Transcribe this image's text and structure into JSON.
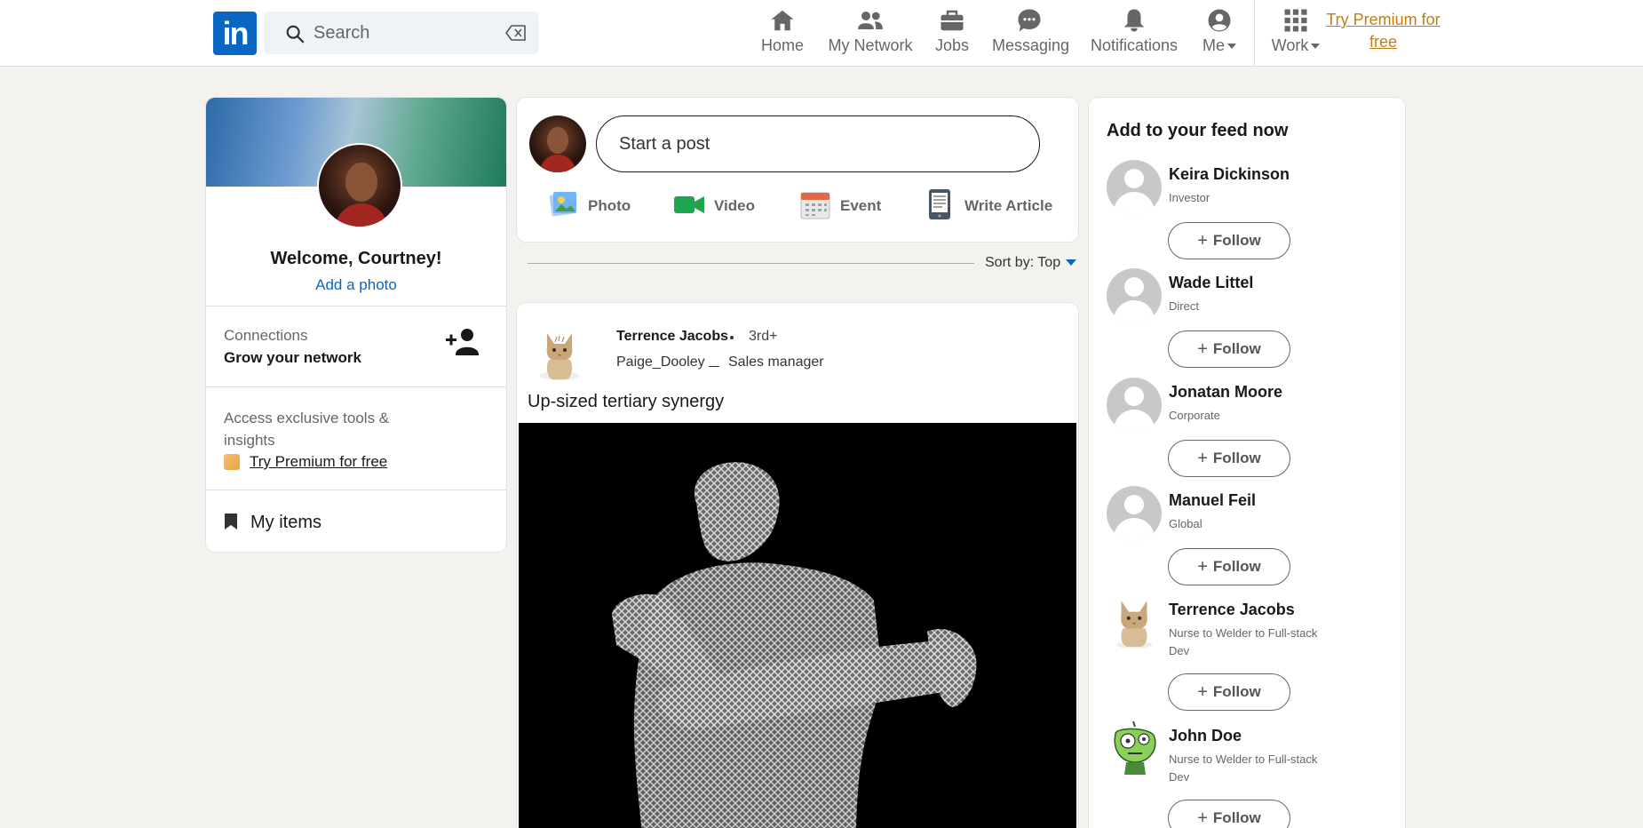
{
  "nav": {
    "logo": "in",
    "search_placeholder": "Search",
    "items": [
      {
        "label": "Home",
        "icon": "home-icon"
      },
      {
        "label": "My Network",
        "icon": "network-icon"
      },
      {
        "label": "Jobs",
        "icon": "briefcase-icon"
      },
      {
        "label": "Messaging",
        "icon": "messaging-icon"
      },
      {
        "label": "Notifications",
        "icon": "bell-icon"
      },
      {
        "label": "Me",
        "icon": "user-icon"
      },
      {
        "label": "Work",
        "icon": "grid-icon"
      }
    ],
    "premium": "Try Premium for free"
  },
  "profile": {
    "welcome": "Welcome, Courtney!",
    "add_photo": "Add a photo",
    "connections_label": "Connections",
    "grow": "Grow your network",
    "access": "Access exclusive tools & insights",
    "premium_link": "Try Premium for free",
    "my_items": "My items"
  },
  "composer": {
    "placeholder": "Start a post",
    "actions": [
      "Photo",
      "Video",
      "Event",
      "Write Article"
    ],
    "colors": {
      "photo": "#70b5f9",
      "video": "#1ea54d",
      "event": "#e06847",
      "article": "#5f6b7a"
    }
  },
  "sort": {
    "label": "Sort by: Top"
  },
  "post": {
    "author": "Terrence Jacobs",
    "degree": "3rd+",
    "handle": "Paige_Dooley",
    "role": "Sales manager",
    "text": "Up-sized tertiary synergy"
  },
  "feed": {
    "title": "Add to your feed now",
    "follow_label": "Follow",
    "people": [
      {
        "name": "Keira Dickinson",
        "desc": "Investor",
        "avatar": "default-avatar"
      },
      {
        "name": "Wade Littel",
        "desc": "Direct",
        "avatar": "default-avatar"
      },
      {
        "name": "Jonatan Moore",
        "desc": "Corporate",
        "avatar": "default-avatar"
      },
      {
        "name": "Manuel Feil",
        "desc": "Global",
        "avatar": "default-avatar"
      },
      {
        "name": "Terrence Jacobs",
        "desc": "Nurse to Welder to Full-stack Dev",
        "avatar": "cat-avatar"
      },
      {
        "name": "John Doe",
        "desc": "Nurse to Welder to Full-stack Dev",
        "avatar": "alien-avatar"
      }
    ]
  },
  "colors": {
    "brand": "#0a66c2",
    "premium": "#c37d16",
    "background": "#f3f2ef"
  }
}
